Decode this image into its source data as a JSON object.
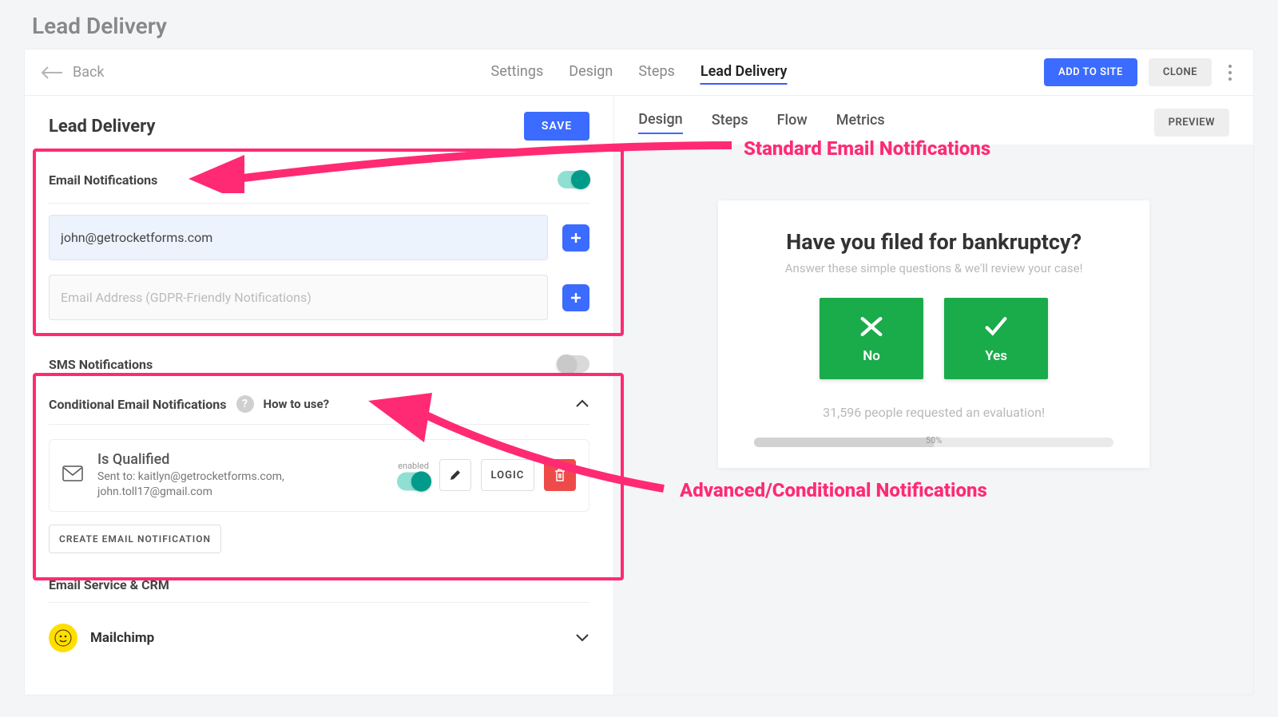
{
  "page_title": "Lead Delivery",
  "top": {
    "back": "Back",
    "tabs": [
      "Settings",
      "Design",
      "Steps",
      "Lead Delivery"
    ],
    "active_index": 3,
    "add_to_site": "ADD TO SITE",
    "clone": "CLONE"
  },
  "left": {
    "title": "Lead Delivery",
    "save": "SAVE",
    "email_section": "Email Notifications",
    "email_toggle": true,
    "email_value": "john@getrocketforms.com",
    "email_gdpr_placeholder": "Email Address (GDPR-Friendly Notifications)",
    "sms_section": "SMS Notifications",
    "sms_toggle": false,
    "cond_section": "Conditional Email Notifications",
    "howto": "How to use?",
    "rule": {
      "name": "Is Qualified",
      "sent": "Sent to: kaitlyn@getrocketforms.com, john.toll17@gmail.com",
      "enabled_label": "enabled"
    },
    "logic": "LOGIC",
    "create": "CREATE EMAIL NOTIFICATION",
    "crm_section": "Email Service & CRM",
    "mailchimp": "Mailchimp"
  },
  "right": {
    "tabs": [
      "Design",
      "Steps",
      "Flow",
      "Metrics"
    ],
    "active_index": 0,
    "preview": "PREVIEW",
    "form": {
      "title": "Have you filed for bankruptcy?",
      "subtitle": "Answer these simple questions & we'll review your case!",
      "no": "No",
      "yes": "Yes",
      "social": "31,596 people requested an evaluation!",
      "progress": "50%"
    }
  },
  "annotations": {
    "standard": "Standard Email Notifications",
    "advanced": "Advanced/Conditional Notifications"
  }
}
